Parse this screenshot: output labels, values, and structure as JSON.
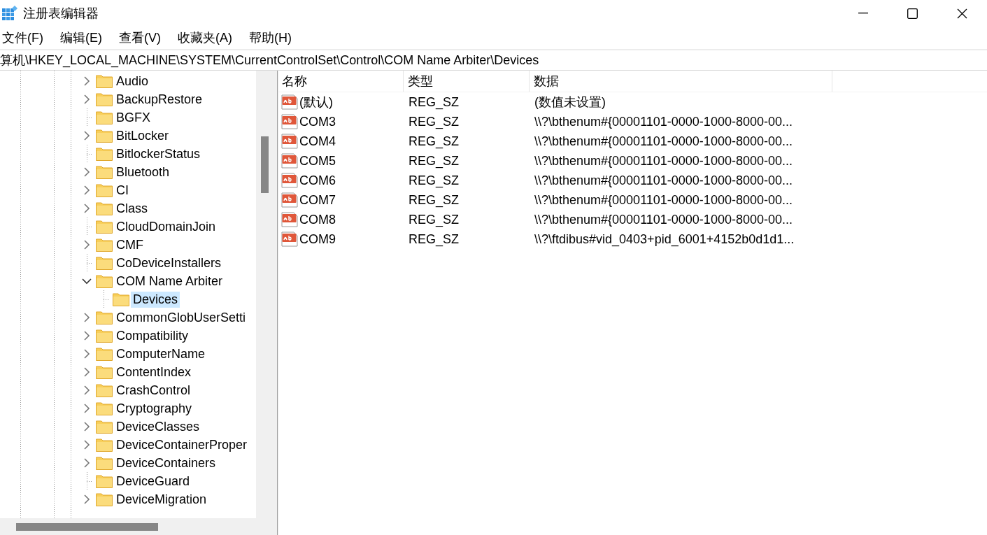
{
  "window": {
    "title": "注册表编辑器"
  },
  "menu": [
    "文件(F)",
    "编辑(E)",
    "查看(V)",
    "收藏夹(A)",
    "帮助(H)"
  ],
  "address": "算机\\HKEY_LOCAL_MACHINE\\SYSTEM\\CurrentControlSet\\Control\\COM Name Arbiter\\Devices",
  "tree": {
    "items": [
      {
        "label": "Audio",
        "expandable": true,
        "expanded": false,
        "selected": false
      },
      {
        "label": "BackupRestore",
        "expandable": true,
        "expanded": false,
        "selected": false
      },
      {
        "label": "BGFX",
        "expandable": false,
        "selected": false
      },
      {
        "label": "BitLocker",
        "expandable": true,
        "expanded": false,
        "selected": false
      },
      {
        "label": "BitlockerStatus",
        "expandable": false,
        "selected": false
      },
      {
        "label": "Bluetooth",
        "expandable": true,
        "expanded": false,
        "selected": false
      },
      {
        "label": "CI",
        "expandable": true,
        "expanded": false,
        "selected": false
      },
      {
        "label": "Class",
        "expandable": true,
        "expanded": false,
        "selected": false
      },
      {
        "label": "CloudDomainJoin",
        "expandable": false,
        "selected": false
      },
      {
        "label": "CMF",
        "expandable": true,
        "expanded": false,
        "selected": false
      },
      {
        "label": "CoDeviceInstallers",
        "expandable": false,
        "selected": false
      },
      {
        "label": "COM Name Arbiter",
        "expandable": true,
        "expanded": true,
        "selected": false,
        "children": [
          {
            "label": "Devices",
            "expandable": false,
            "selected": true
          }
        ]
      },
      {
        "label": "CommonGlobUserSetti",
        "expandable": true,
        "expanded": false,
        "selected": false
      },
      {
        "label": "Compatibility",
        "expandable": true,
        "expanded": false,
        "selected": false
      },
      {
        "label": "ComputerName",
        "expandable": true,
        "expanded": false,
        "selected": false
      },
      {
        "label": "ContentIndex",
        "expandable": true,
        "expanded": false,
        "selected": false
      },
      {
        "label": "CrashControl",
        "expandable": true,
        "expanded": false,
        "selected": false
      },
      {
        "label": "Cryptography",
        "expandable": true,
        "expanded": false,
        "selected": false
      },
      {
        "label": "DeviceClasses",
        "expandable": true,
        "expanded": false,
        "selected": false
      },
      {
        "label": "DeviceContainerProper",
        "expandable": true,
        "expanded": false,
        "selected": false
      },
      {
        "label": "DeviceContainers",
        "expandable": true,
        "expanded": false,
        "selected": false
      },
      {
        "label": "DeviceGuard",
        "expandable": false,
        "selected": false
      },
      {
        "label": "DeviceMigration",
        "expandable": true,
        "expanded": false,
        "selected": false
      }
    ]
  },
  "values": {
    "columns": [
      "名称",
      "类型",
      "数据"
    ],
    "rows": [
      {
        "name": "(默认)",
        "type": "REG_SZ",
        "data": "(数值未设置)"
      },
      {
        "name": "COM3",
        "type": "REG_SZ",
        "data": "\\\\?\\bthenum#{00001101-0000-1000-8000-00..."
      },
      {
        "name": "COM4",
        "type": "REG_SZ",
        "data": "\\\\?\\bthenum#{00001101-0000-1000-8000-00..."
      },
      {
        "name": "COM5",
        "type": "REG_SZ",
        "data": "\\\\?\\bthenum#{00001101-0000-1000-8000-00..."
      },
      {
        "name": "COM6",
        "type": "REG_SZ",
        "data": "\\\\?\\bthenum#{00001101-0000-1000-8000-00..."
      },
      {
        "name": "COM7",
        "type": "REG_SZ",
        "data": "\\\\?\\bthenum#{00001101-0000-1000-8000-00..."
      },
      {
        "name": "COM8",
        "type": "REG_SZ",
        "data": "\\\\?\\bthenum#{00001101-0000-1000-8000-00..."
      },
      {
        "name": "COM9",
        "type": "REG_SZ",
        "data": "\\\\?\\ftdibus#vid_0403+pid_6001+4152b0d1d1..."
      }
    ]
  }
}
